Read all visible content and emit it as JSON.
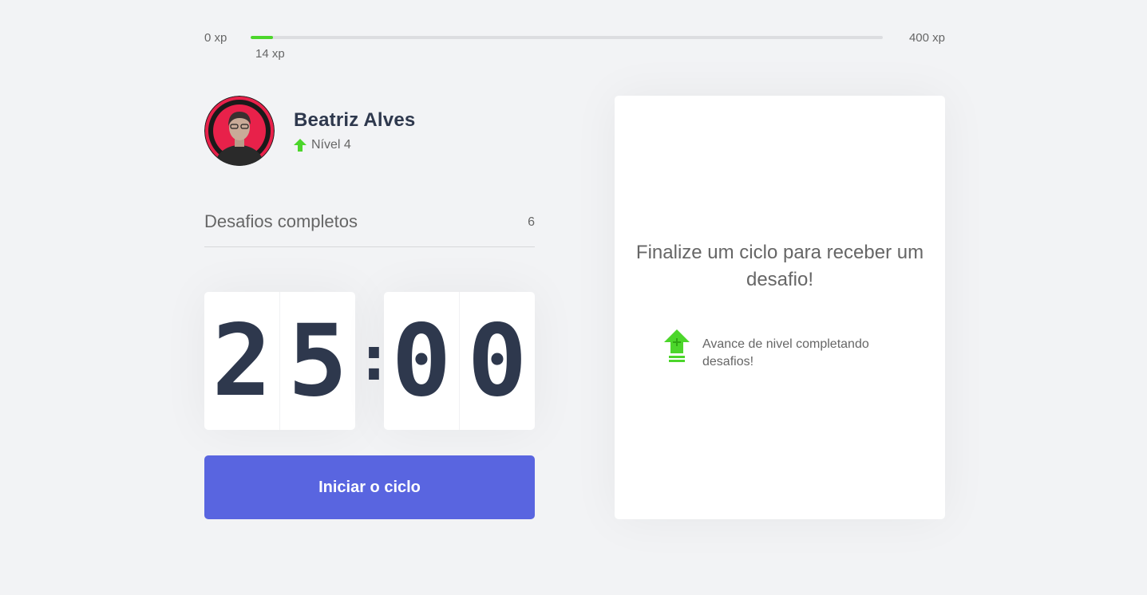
{
  "experience_bar": {
    "min_label": "0 xp",
    "max_label": "400 xp",
    "current_label": "14 xp",
    "progress_fraction": 0.035,
    "fill_color": "#4cd62b"
  },
  "profile": {
    "name": "Beatriz Alves",
    "level_label": "Nível 4",
    "avatar_ring_color": "#e8214a",
    "level_icon": "level-up-arrow-icon"
  },
  "completed_challenges": {
    "label": "Desafios completos",
    "count": "6"
  },
  "countdown": {
    "minute_left": "2",
    "minute_right": "5",
    "separator": ":",
    "second_left": "0",
    "second_right": "0"
  },
  "start_button": {
    "label": "Iniciar o ciclo",
    "color": "#5965e0"
  },
  "challenge_box": {
    "title": "Finalize um ciclo para receber um desafio!",
    "hint_text": "Avance de nivel completando desafios!",
    "hint_icon": "level-up-icon"
  }
}
